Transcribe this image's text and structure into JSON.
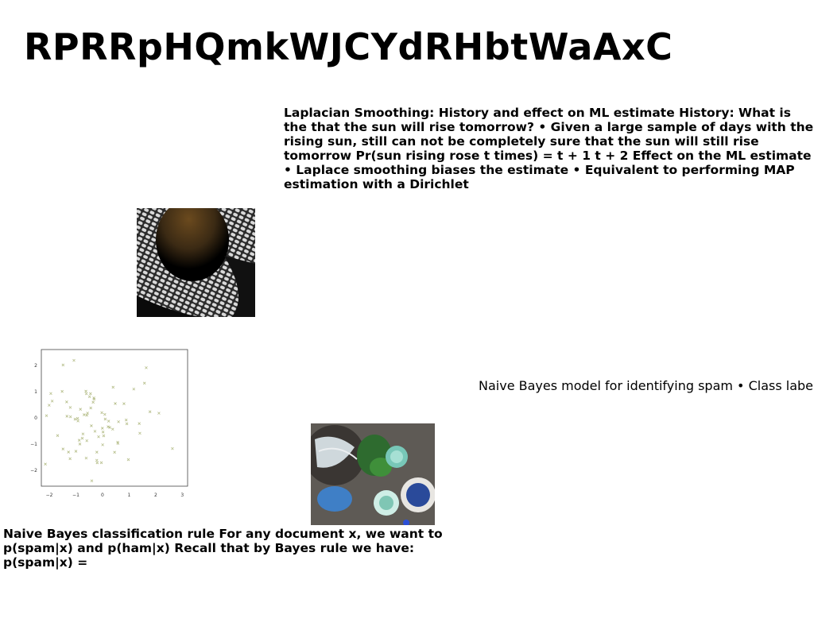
{
  "title": "RPRRpHQmkWJCYdRHbtWaAxC",
  "blocks": {
    "laplacian": "Laplacian Smoothing: History and effect on ML estimate History: What is the that the sun will rise tomorrow? • Given a large sample of days with the rising sun, still can not be completely sure that the sun will still rise tomorrow Pr(sun rising rose t times) = t + 1 t + 2 Effect on the ML estimate • Laplace smoothing biases the estimate • Equivalent to performing MAP estimation with a Dirichlet",
    "classification": "Naive Bayes classification rule For any document x, we want to p(spam|x) and p(ham|x) Recall that by Bayes rule we have: p(spam|x) =",
    "spam_model": "Naive Bayes model for identifying spam • Class label:"
  },
  "scatter": {
    "x_ticks": [
      "−2",
      "−1",
      "0",
      "1",
      "2",
      "3"
    ],
    "y_ticks": [
      "2",
      "1",
      "0",
      "−1",
      "−2"
    ],
    "point_color": "#b6be8a"
  },
  "colors": {
    "text": "#000000",
    "background": "#ffffff"
  }
}
